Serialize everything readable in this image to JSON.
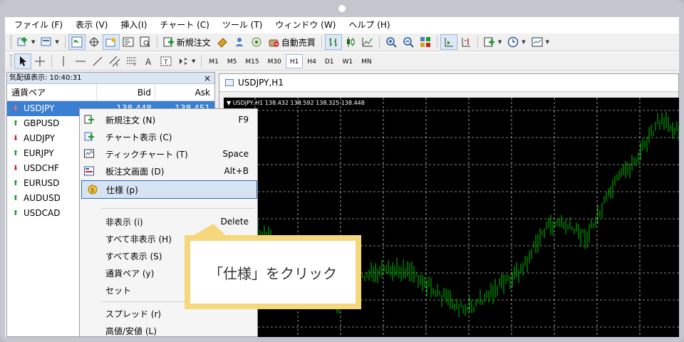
{
  "menubar": [
    "ファイル (F)",
    "表示 (V)",
    "挿入(I)",
    "チャート (C)",
    "ツール (T)",
    "ウィンドウ (W)",
    "ヘルプ (H)"
  ],
  "toolbar": {
    "new_order": "新規注文",
    "auto_trade": "自動売買"
  },
  "timeframes": [
    "M1",
    "M5",
    "M15",
    "M30",
    "H1",
    "H4",
    "D1",
    "W1",
    "MN"
  ],
  "active_timeframe": "H1",
  "market_watch": {
    "title": "気配値表示: 10:40:31",
    "close_glyph": "×",
    "columns": {
      "symbol": "通貨ペア",
      "bid": "Bid",
      "ask": "Ask"
    },
    "rows": [
      {
        "symbol": "USDJPY",
        "direction": "down",
        "bid": "138.448",
        "ask": "138.451",
        "selected": true
      },
      {
        "symbol": "GBPUSD",
        "direction": "up"
      },
      {
        "symbol": "AUDJPY",
        "direction": "down"
      },
      {
        "symbol": "EURJPY",
        "direction": "up"
      },
      {
        "symbol": "USDCHF",
        "direction": "down"
      },
      {
        "symbol": "EURUSD",
        "direction": "up"
      },
      {
        "symbol": "AUDUSD",
        "direction": "up"
      },
      {
        "symbol": "USDCAD",
        "direction": "up"
      }
    ]
  },
  "chart_window": {
    "title": "USDJPY,H1",
    "info": "USDJPY,H1  138.432 138.592 138.325 138.448"
  },
  "context_menu": {
    "items": [
      {
        "label": "新規注文 (N)",
        "shortcut": "F9",
        "icon": "new-order-icon"
      },
      {
        "label": "チャート表示 (C)",
        "shortcut": "",
        "icon": "chart-window-icon"
      },
      {
        "label": "ティックチャート (T)",
        "shortcut": "Space",
        "icon": "tick-chart-icon"
      },
      {
        "label": "板注文画面 (D)",
        "shortcut": "Alt+B",
        "icon": "depth-of-market-icon"
      },
      {
        "label": "仕様 (p)",
        "shortcut": "",
        "icon": "specification-icon",
        "highlighted": true
      },
      {
        "label": "非表示 (i)",
        "shortcut": "Delete",
        "icon": ""
      },
      {
        "label": "すべて非表示 (H)",
        "shortcut": "",
        "icon": ""
      },
      {
        "label": "すべて表示 (S)",
        "shortcut": "",
        "icon": ""
      },
      {
        "label": "通貨ペア (y)",
        "shortcut": "",
        "icon": ""
      },
      {
        "label": "セット",
        "shortcut": "",
        "icon": ""
      },
      {
        "label": "スプレッド (r)",
        "shortcut": "",
        "icon": ""
      },
      {
        "label": "高値/安値 (L)",
        "shortcut": "",
        "icon": ""
      }
    ]
  },
  "callout": {
    "text": "「仕様」をクリック"
  },
  "colors": {
    "chart_background": "#000000",
    "candle_color": "#00c000",
    "grid_color": "#ffffff",
    "selection_blue": "#3b7fd3",
    "callout_yellow": "#f6d77b",
    "down_arrow": "#d02020",
    "up_arrow": "#1c9a2a"
  }
}
